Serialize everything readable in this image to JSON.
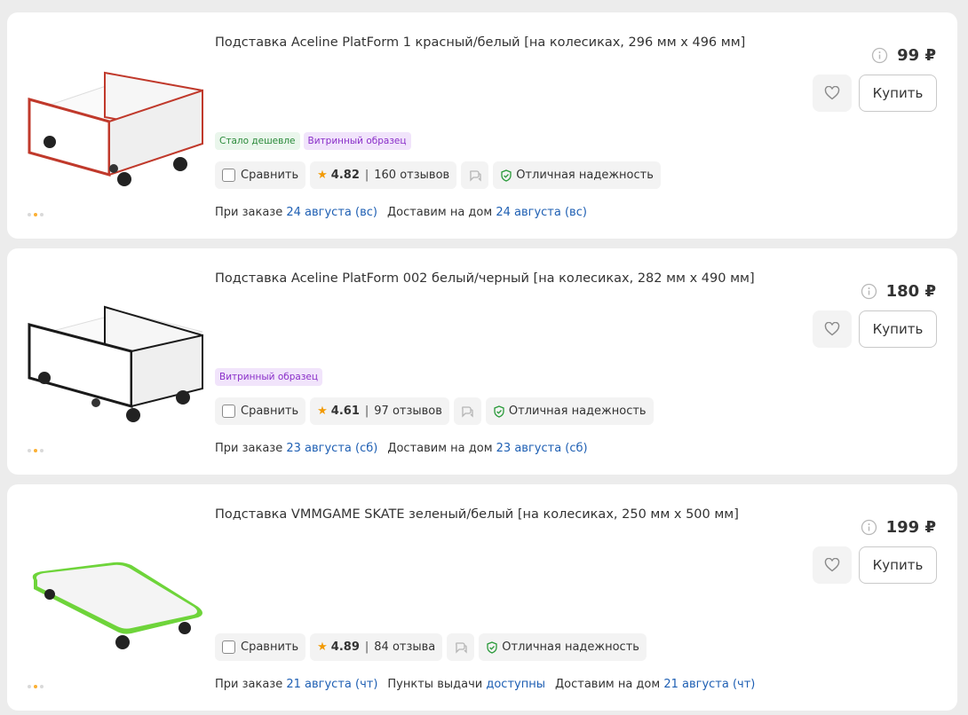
{
  "products": [
    {
      "title": "Подставка Aceline PlatForm 1 красный/белый [на колесиках, 296 мм x 496 мм]",
      "image": {
        "icon": "stand-red-image",
        "accent": "#c0392b"
      },
      "badges": [
        {
          "label": "Стало дешевле",
          "style": "green"
        },
        {
          "label": "Витринный образец",
          "style": "purple"
        }
      ],
      "compare_label": "Сравнить",
      "rating": "4.82",
      "reviews": "160 отзывов",
      "reliability": "Отличная надежность",
      "price": "99 ₽",
      "buy_label": "Купить",
      "delivery": [
        {
          "label": "При заказе",
          "link": "24 августа (вс)"
        },
        {
          "label": "Доставим на дом",
          "link": "24 августа (вс)"
        }
      ]
    },
    {
      "title": "Подставка Aceline PlatForm 002 белый/черный [на колесиках, 282 мм x 490 мм]",
      "image": {
        "icon": "stand-black-image",
        "accent": "#1a1a1a"
      },
      "badges": [
        {
          "label": "Витринный образец",
          "style": "purple"
        }
      ],
      "compare_label": "Сравнить",
      "rating": "4.61",
      "reviews": "97 отзывов",
      "reliability": "Отличная надежность",
      "price": "180 ₽",
      "buy_label": "Купить",
      "delivery": [
        {
          "label": "При заказе",
          "link": "23 августа (сб)"
        },
        {
          "label": "Доставим на дом",
          "link": "23 августа (сб)"
        }
      ]
    },
    {
      "title": "Подставка VMMGAME SKATE зеленый/белый [на колесиках, 250 мм x 500 мм]",
      "image": {
        "icon": "skate-green-image",
        "accent": "#6ed43a"
      },
      "badges": [],
      "compare_label": "Сравнить",
      "rating": "4.89",
      "reviews": "84 отзыва",
      "reliability": "Отличная надежность",
      "price": "199 ₽",
      "buy_label": "Купить",
      "delivery": [
        {
          "label": "При заказе",
          "link": "21 августа (чт)"
        },
        {
          "label": "Пункты выдачи",
          "link": "доступны"
        },
        {
          "label": "Доставим на дом",
          "link": "21 августа (чт)"
        }
      ]
    }
  ]
}
